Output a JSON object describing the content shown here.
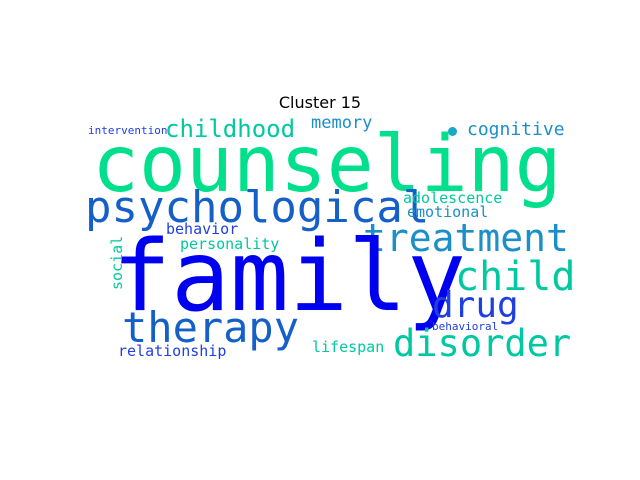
{
  "title": "Cluster 15",
  "colors": {
    "green": "#00e08c",
    "teal": "#00c8a0",
    "cyan_blue": "#1a8fc8",
    "mid_blue": "#1560c8",
    "royal_blue": "#1f3fe0",
    "pure_blue": "#0000f0"
  },
  "words": {
    "counseling": "counseling",
    "family": "family",
    "psychological": "psychological",
    "treatment": "treatment",
    "therapy": "therapy",
    "child": "child",
    "drug": "drug",
    "disorder": "disorder",
    "childhood": "childhood",
    "cognitive": "cognitive",
    "memory": "memory",
    "intervention": "intervention",
    "adolescence": "adolescence",
    "emotional": "emotional",
    "behavior": "behavior",
    "personality": "personality",
    "social": "social",
    "relationship": "relationship",
    "lifespan": "lifespan",
    "behavioral": "behavioral"
  }
}
